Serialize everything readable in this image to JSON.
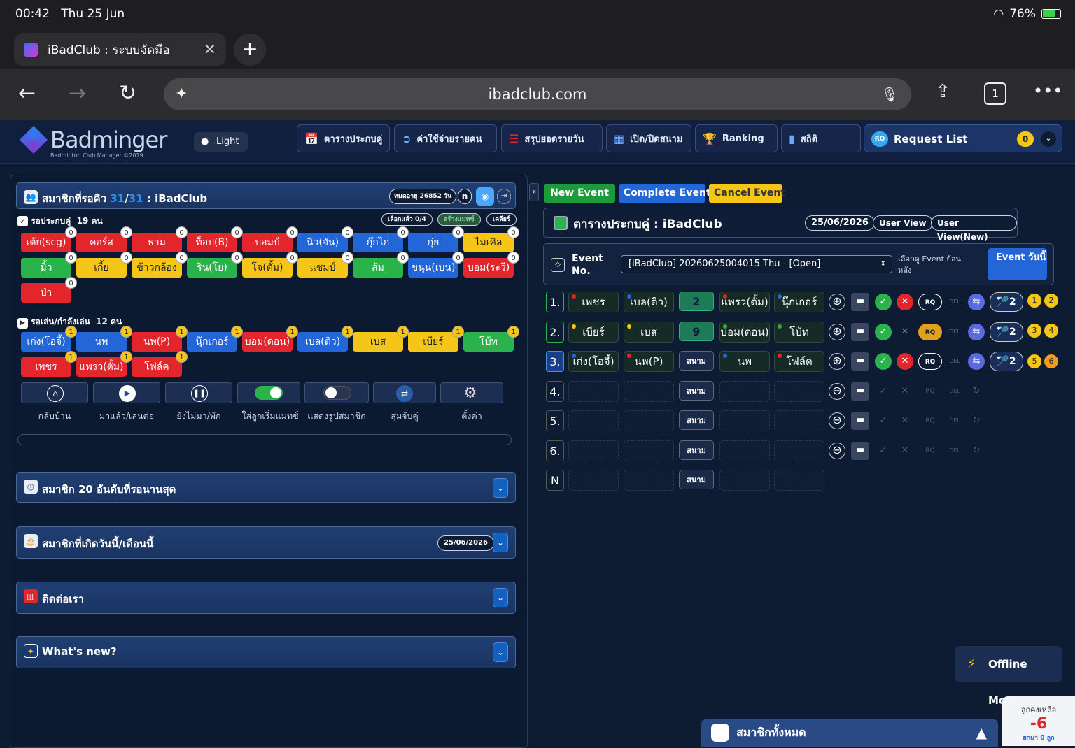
{
  "status": {
    "time": "00:42",
    "date": "Thu 25 Jun",
    "battery": "76%"
  },
  "browser": {
    "tab_title": "iBadClub : ระบบจัดมือ",
    "url": "ibadclub.com",
    "tab_count": "1"
  },
  "app": {
    "logo": "Badminger",
    "logo_sub": "Badminton Club Manager ©2019",
    "light_label": "Light",
    "nav": [
      "ตารางประกบคู่",
      "ค่าใช้จ่ายรายคน",
      "สรุปยอดรายวัน",
      "เปิด/ปิดสนาม",
      "Ranking",
      "สถิติ"
    ],
    "request_list": "Request List",
    "request_count": "0",
    "rq": "RQ"
  },
  "queue": {
    "title": "สมาชิกที่รอคิว",
    "count_a": "31",
    "count_b": "31",
    "club": ": iBadClub",
    "expiry": "หมดอายุ 26852 วัน",
    "n_btn": "n",
    "waiting_label": "รอประกบคู่",
    "waiting_count": "19 คน",
    "selected": "เลือกแล้ว 0/4",
    "make_match": "สร้างแมทช์",
    "clear": "เคลียร์",
    "waiting": [
      {
        "n": "เต้ย(scg)",
        "c": "red",
        "b": "0"
      },
      {
        "n": "คอร์ส",
        "c": "red",
        "b": "0"
      },
      {
        "n": "ธาม",
        "c": "red",
        "b": "0"
      },
      {
        "n": "ท็อป(B)",
        "c": "red",
        "b": "0"
      },
      {
        "n": "บอมบ์",
        "c": "red",
        "b": "0"
      },
      {
        "n": "นิว(จัน)",
        "c": "blue",
        "b": "0"
      },
      {
        "n": "กุ๊กไก่",
        "c": "blue",
        "b": "0"
      },
      {
        "n": "กุ่ย",
        "c": "blue",
        "b": "0"
      },
      {
        "n": "ไมเคิล",
        "c": "yellow",
        "b": "0"
      },
      {
        "n": "มิ้ว",
        "c": "green",
        "b": "0"
      },
      {
        "n": "เกี้ย",
        "c": "yellow",
        "b": "0"
      },
      {
        "n": "ข้าวกล้อง",
        "c": "yellow",
        "b": "0"
      },
      {
        "n": "ริน(โย)",
        "c": "green",
        "b": "0"
      },
      {
        "n": "โจ(ตั้ม)",
        "c": "yellow",
        "b": "0"
      },
      {
        "n": "แชมป์",
        "c": "yellow",
        "b": "0"
      },
      {
        "n": "ส้ม",
        "c": "green",
        "b": "0"
      },
      {
        "n": "ขนุน(เบน)",
        "c": "blue",
        "b": "0"
      },
      {
        "n": "บอม(ระวี)",
        "c": "red",
        "b": "0"
      },
      {
        "n": "ป่า",
        "c": "red",
        "b": "0"
      }
    ],
    "playing_label": "รอเล่น/กำลังเล่น",
    "playing_count": "12 คน",
    "playing": [
      {
        "n": "เก่ง(โอจี้)",
        "c": "blue",
        "b": "1"
      },
      {
        "n": "นพ",
        "c": "blue",
        "b": "1"
      },
      {
        "n": "นพ(P)",
        "c": "red",
        "b": "1"
      },
      {
        "n": "นุ๊กเกอร์",
        "c": "blue",
        "b": "1"
      },
      {
        "n": "บอม(ดอน)",
        "c": "red",
        "b": "1"
      },
      {
        "n": "เบล(ติว)",
        "c": "blue",
        "b": "1"
      },
      {
        "n": "เบส",
        "c": "yellow",
        "b": "1"
      },
      {
        "n": "เบียร์",
        "c": "yellow",
        "b": "1"
      },
      {
        "n": "โบ้ท",
        "c": "green",
        "b": "1"
      },
      {
        "n": "เพชร",
        "c": "red",
        "b": "1"
      },
      {
        "n": "แพรว(ตั้ม)",
        "c": "red",
        "b": "1"
      },
      {
        "n": "โฟล์ค",
        "c": "red",
        "b": "1"
      }
    ],
    "actions": [
      "กลับบ้าน",
      "มาแล้ว/เล่นต่อ",
      "ยังไม่มา/พัก",
      "ใส่ลูกเริ่มแมทซ์",
      "แสดงรูปสมาชิก",
      "สุ่มจับคู่",
      "ตั้งค่า"
    ]
  },
  "cards": {
    "longest": "สมาชิก 20 อันดับที่รอนานสุด",
    "birthday": "สมาชิกที่เกิดวันนี้/เดือนนี้",
    "birthday_date": "25/06/2026",
    "contact": "ติดต่อเรา",
    "whatsnew": "What's new?"
  },
  "events": {
    "new": "New Event",
    "complete": "Complete Event",
    "cancel": "Cancel Event"
  },
  "schedule": {
    "title": "ตารางประกบคู่ : iBadClub",
    "date": "25/06/2026",
    "user_view": "User View",
    "user_view_new": "User View(New)",
    "event_no": "Event No.",
    "event_select": "[iBadClub] 20260625004015 Thu - [Open]",
    "past_label": "เลือกดู Event ย้อนหลัง",
    "today_btn": "Event วันนี้",
    "rows": [
      {
        "no": "1.",
        "p": [
          "เพชร",
          "เบล(ติว)",
          "แพรว(ตั้ม)",
          "นุ๊กเกอร์"
        ],
        "court": "2",
        "shuttle": "2",
        "b1": "1",
        "b2": "2"
      },
      {
        "no": "2.",
        "p": [
          "เบียร์",
          "เบส",
          "บอม(ดอน)",
          "โบ้ท"
        ],
        "court": "9",
        "shuttle": "2",
        "b1": "3",
        "b2": "4"
      },
      {
        "no": "3.",
        "p": [
          "เก่ง(โอจี้)",
          "นพ(P)",
          "นพ",
          "โฟล์ค"
        ],
        "court": "สนาม",
        "shuttle": "2",
        "b1": "5",
        "b2": "6"
      },
      {
        "no": "4.",
        "court": "สนาม"
      },
      {
        "no": "5.",
        "court": "สนาม"
      },
      {
        "no": "6.",
        "court": "สนาม"
      },
      {
        "no": "N",
        "court": "สนาม"
      }
    ],
    "rq": "RQ",
    "del": "DEL"
  },
  "offline": "Offline Mode",
  "all_members": "สมาชิกทั้งหมด",
  "balls": {
    "label": "ลูกคงเหลือ",
    "value": "-6",
    "sub": "ยกมา 0 ลูก"
  },
  "colors": {
    "red": "#e3262b",
    "green": "#2ab34a",
    "yellow": "#f5c518",
    "blue": "#2366d8"
  }
}
